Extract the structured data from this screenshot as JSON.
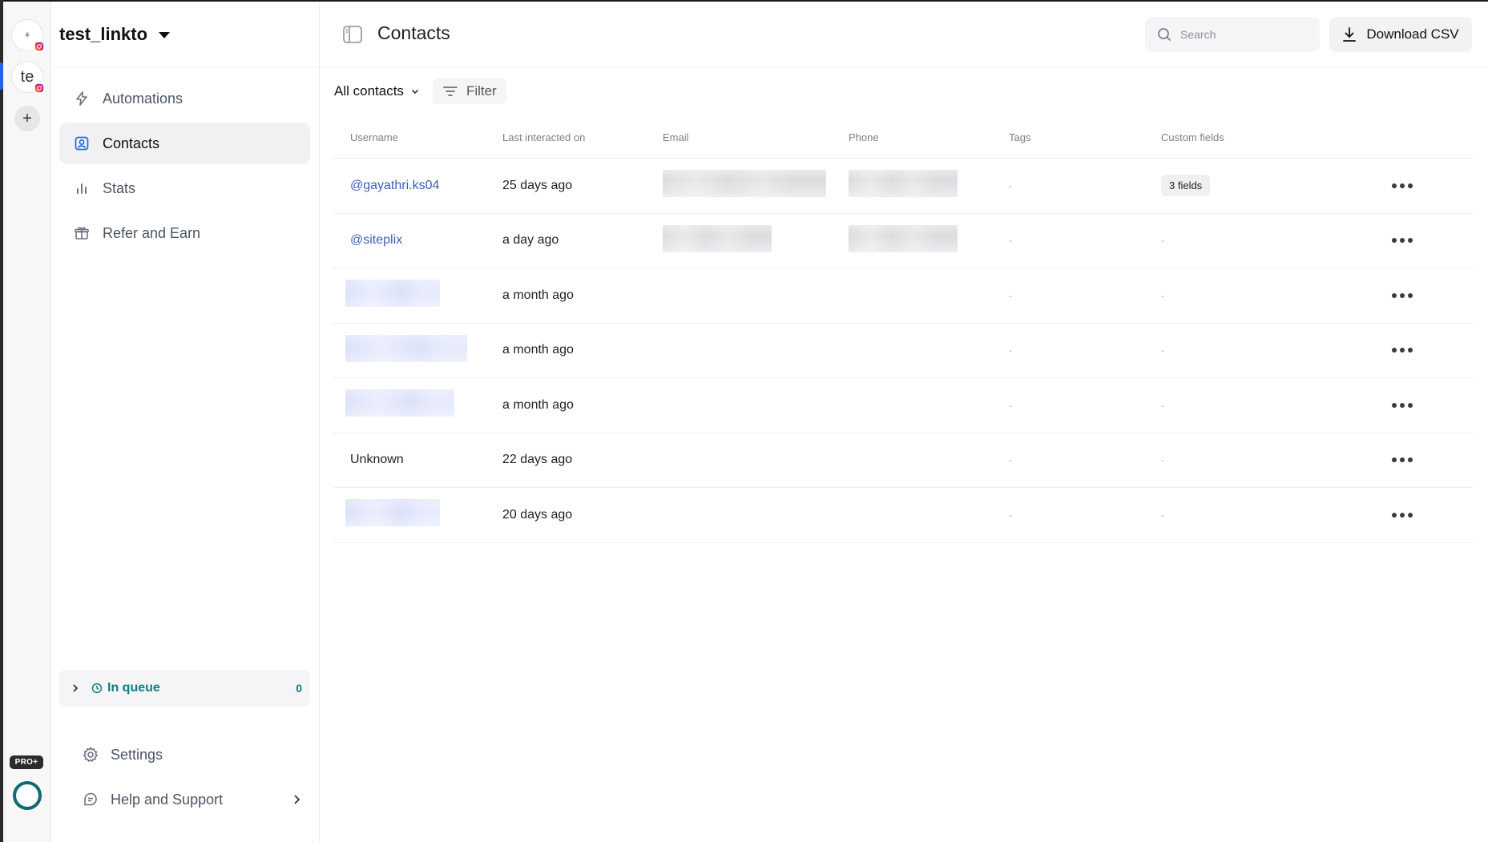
{
  "rail": {
    "accounts": [
      {
        "initials": "",
        "logo_text": "⚘",
        "platform": "instagram"
      },
      {
        "initials": "te",
        "platform": "instagram"
      }
    ],
    "add_label": "+",
    "plan_badge": "PRO+"
  },
  "sidebar": {
    "workspace_name": "test_linkto",
    "items": [
      {
        "label": "Automations",
        "icon": "lightning-icon"
      },
      {
        "label": "Contacts",
        "icon": "contacts-icon"
      },
      {
        "label": "Stats",
        "icon": "bar-chart-icon"
      },
      {
        "label": "Refer and Earn",
        "icon": "gift-icon"
      }
    ],
    "queue": {
      "label": "In queue",
      "count": "0"
    },
    "bottom": [
      {
        "label": "Settings",
        "icon": "gear-icon"
      },
      {
        "label": "Help and Support",
        "icon": "help-chat-icon"
      }
    ]
  },
  "header": {
    "title": "Contacts",
    "search_placeholder": "Search",
    "download_label": "Download CSV"
  },
  "filters": {
    "view_label": "All contacts",
    "filter_label": "Filter"
  },
  "table": {
    "columns": [
      "Username",
      "Last interacted on",
      "Email",
      "Phone",
      "Tags",
      "Custom fields"
    ],
    "rows": [
      {
        "username": "@gayathri.ks04",
        "last": "25 days ago",
        "tags": "-",
        "custom": "3 fields"
      },
      {
        "username": "@siteplix",
        "last": "a day ago",
        "tags": "-",
        "custom": "-"
      },
      {
        "username": "",
        "last": "a month ago",
        "tags": "-",
        "custom": "-"
      },
      {
        "username": "",
        "last": "a month ago",
        "tags": "-",
        "custom": "-"
      },
      {
        "username": "",
        "last": "a month ago",
        "tags": "-",
        "custom": "-"
      },
      {
        "username": "Unknown",
        "last": "22 days ago",
        "tags": "-",
        "custom": "-"
      },
      {
        "username": "",
        "last": "20 days ago",
        "tags": "-",
        "custom": "-"
      }
    ]
  },
  "colors": {
    "accent": "#2563eb",
    "queue": "#0e7c86",
    "link": "#3b5fb8"
  }
}
